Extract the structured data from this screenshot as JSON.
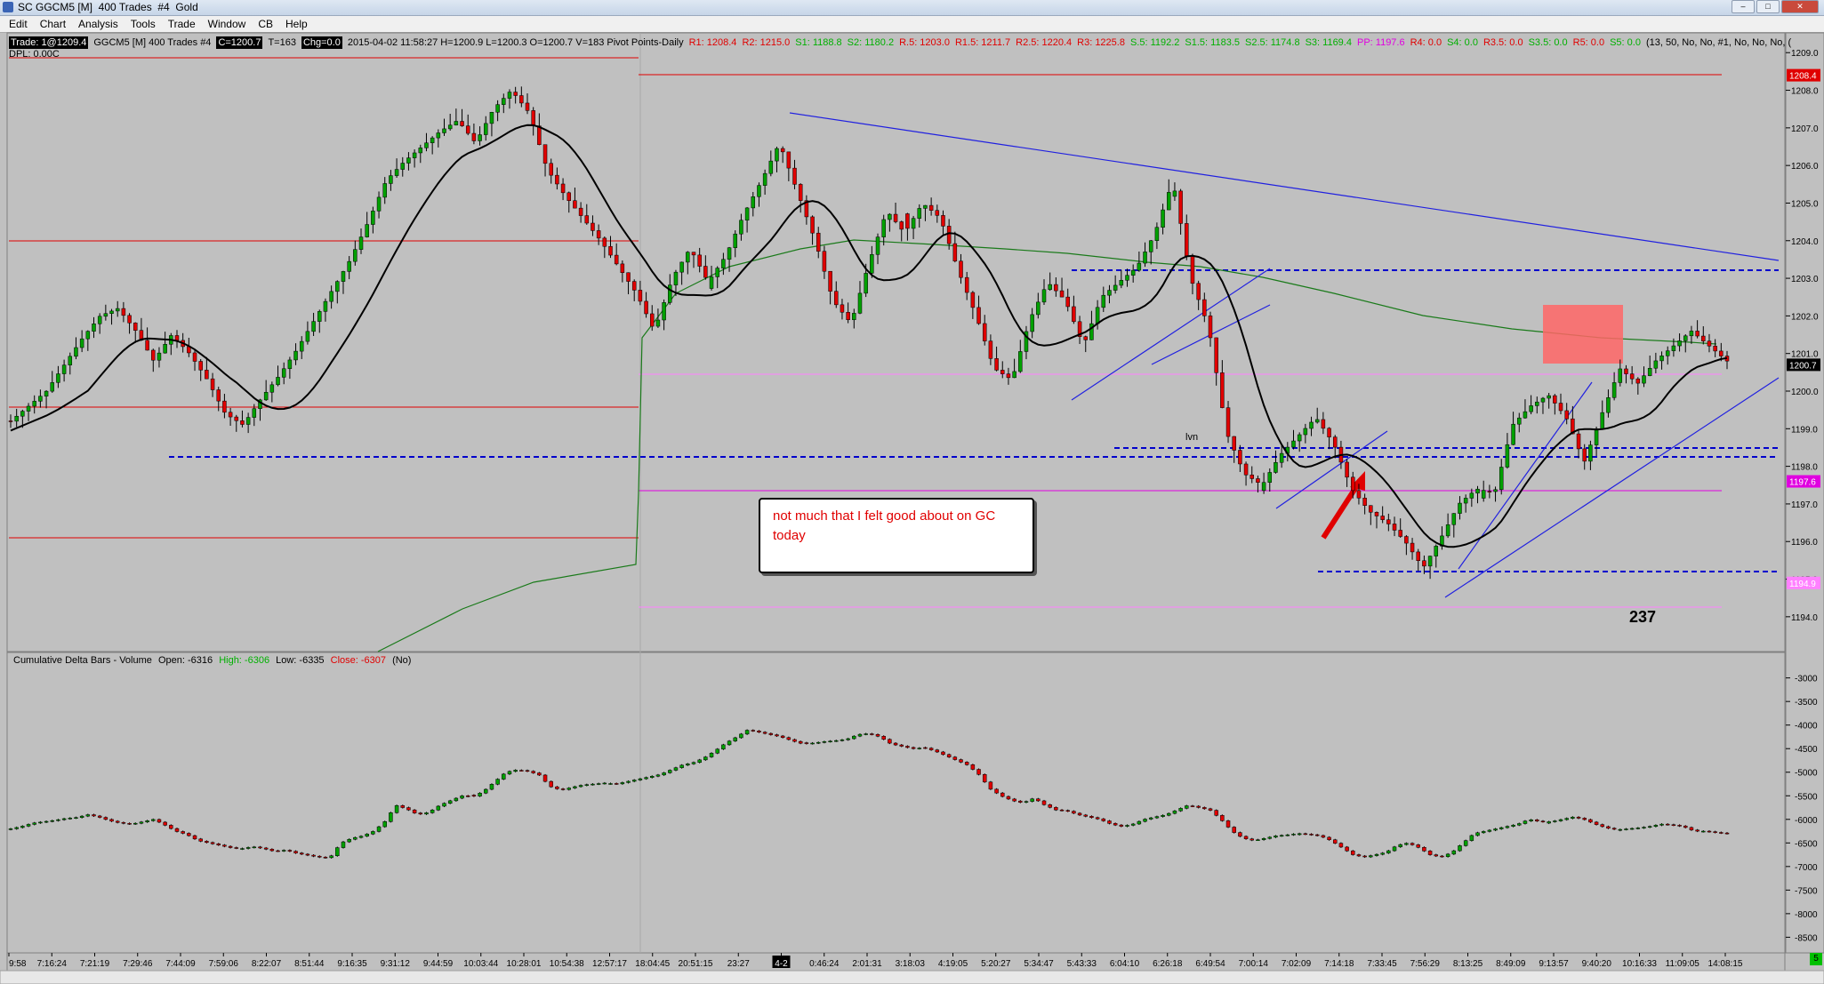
{
  "window": {
    "title": "SC GGCM5 [M]  400 Trades  #4  Gold",
    "buttons": [
      "–",
      "□",
      "✕"
    ]
  },
  "menu": [
    "Edit",
    "Chart",
    "Analysis",
    "Tools",
    "Trade",
    "Window",
    "CB",
    "Help"
  ],
  "info": {
    "trade": "Trade: 1@1209.4",
    "symbol": "GGCM5 [M]  400 Trades  #4",
    "close": "C=1200.7",
    "trades": "T=163",
    "chg": "Chg=0.0",
    "datetime": "2015-04-02 11:58:27 H=1200.9 L=1200.3 O=1200.7 V=183 Pivot Points-Daily",
    "dpl": "DPL: 0.00C",
    "pivots": [
      {
        "text": "R1: 1208.4",
        "color": "#e00000"
      },
      {
        "text": "R2: 1215.0",
        "color": "#e00000"
      },
      {
        "text": "S1: 1188.8",
        "color": "#00b000"
      },
      {
        "text": "S2: 1180.2",
        "color": "#00b000"
      },
      {
        "text": "R.5: 1203.0",
        "color": "#e00000"
      },
      {
        "text": "R1.5: 1211.7",
        "color": "#e00000"
      },
      {
        "text": "R2.5: 1220.4",
        "color": "#e00000"
      },
      {
        "text": "R3: 1225.8",
        "color": "#e00000"
      },
      {
        "text": "S.5: 1192.2",
        "color": "#00b000"
      },
      {
        "text": "S1.5: 1183.5",
        "color": "#00b000"
      },
      {
        "text": "S2.5: 1174.8",
        "color": "#00b000"
      },
      {
        "text": "S3: 1169.4",
        "color": "#00b000"
      },
      {
        "text": "PP: 1197.6",
        "color": "#e000e0"
      },
      {
        "text": "R4: 0.0",
        "color": "#e00000"
      },
      {
        "text": "S4: 0.0",
        "color": "#00b000"
      },
      {
        "text": "R3.5: 0.0",
        "color": "#e00000"
      },
      {
        "text": "S3.5: 0.0",
        "color": "#00b000"
      },
      {
        "text": "R5: 0.0",
        "color": "#e00000"
      },
      {
        "text": "S5: 0.0",
        "color": "#00b000"
      },
      {
        "text": "(13, 50, No, No, #1, No, No, No, (",
        "color": "#000000"
      }
    ]
  },
  "lower_legend": {
    "name": "Cumulative Delta Bars - Volume",
    "open": "Open: -6316",
    "high": "High: -6306",
    "low": "Low: -6335",
    "close": "Close: -6307",
    "extra": "(No)"
  },
  "annotation": {
    "line1": "not much that I felt good about on GC",
    "line2": "today"
  },
  "big_number": "237",
  "lvn_label": "lvn",
  "status_corner": "5",
  "colors": {
    "up": "#00a000",
    "down": "#e00000",
    "bg": "#c0c0c0",
    "blue_dash": "#0000cc",
    "pivot_pp": "#e000e0"
  },
  "chart_data": [
    {
      "type": "candlestick",
      "y_ticks": [
        "1209.0",
        "1208.0",
        "1207.0",
        "1206.0",
        "1205.0",
        "1204.0",
        "1203.0",
        "1202.0",
        "1201.0",
        "1200.0",
        "1199.0",
        "1198.0",
        "1197.0",
        "1196.0",
        "1195.0",
        "1194.0"
      ],
      "ylim": [
        1193.5,
        1209.1
      ],
      "price_labels": [
        {
          "text": "1208.4",
          "value": 1208.4,
          "bg": "#e00000",
          "fg": "#ffffff"
        },
        {
          "text": "1200.7",
          "value": 1200.7,
          "bg": "#000000",
          "fg": "#ffffff"
        },
        {
          "text": "1197.6",
          "value": 1197.6,
          "bg": "#e000e0",
          "fg": "#ffffff"
        },
        {
          "text": "1194.9",
          "value": 1194.9,
          "bg": "#ff80ff",
          "fg": "#ffffff"
        }
      ],
      "close_path": [
        1199.2,
        1199.6,
        1200.0,
        1200.7,
        1201.4,
        1202.0,
        1202.2,
        1201.6,
        1200.8,
        1201.5,
        1201.0,
        1200.3,
        1199.4,
        1199.1,
        1199.8,
        1200.4,
        1201.1,
        1201.9,
        1202.7,
        1203.5,
        1204.5,
        1205.6,
        1206.1,
        1206.5,
        1206.9,
        1207.2,
        1206.6,
        1207.5,
        1208.0,
        1207.4,
        1205.9,
        1205.2,
        1204.6,
        1204.0,
        1203.3,
        1202.6,
        1201.6,
        1203.0,
        1203.8,
        1202.9,
        1203.6,
        1204.7,
        1205.6,
        1206.6,
        1205.3,
        1204.0,
        1202.4,
        1201.8,
        1203.4,
        1204.8,
        1204.2,
        1205.0,
        1204.6,
        1203.2,
        1202.0,
        1200.6,
        1200.3,
        1201.9,
        1202.9,
        1202.4,
        1201.2,
        1202.5,
        1202.9,
        1203.3,
        1204.2,
        1205.6,
        1203.0,
        1201.7,
        1198.9,
        1197.8,
        1197.5,
        1198.3,
        1198.8,
        1199.3,
        1198.6,
        1197.4,
        1196.8,
        1196.5,
        1196.0,
        1195.3,
        1196.1,
        1197.0,
        1197.4,
        1197.3,
        1199.1,
        1199.6,
        1199.9,
        1199.3,
        1198.1,
        1199.4,
        1200.6,
        1200.2,
        1200.8,
        1201.2,
        1201.6,
        1201.2,
        1200.8
      ]
    },
    {
      "type": "candlestick",
      "title": "Cumulative Delta Bars - Volume",
      "y_ticks": [
        "-3000",
        "-3500",
        "-4000",
        "-4500",
        "-5000",
        "-5500",
        "-6000",
        "-6500",
        "-7000",
        "-7500",
        "-8000",
        "-8500"
      ],
      "ylim": [
        -8700,
        -2950
      ],
      "close_path": [
        -6200,
        -6150,
        -6080,
        -6050,
        -6020,
        -5980,
        -5960,
        -5900,
        -5950,
        -6030,
        -6080,
        -6100,
        -6050,
        -6000,
        -6120,
        -6250,
        -6320,
        -6450,
        -6500,
        -6550,
        -6600,
        -6620,
        -6580,
        -6620,
        -6680,
        -6650,
        -6720,
        -6760,
        -6800,
        -6820,
        -6500,
        -6400,
        -6350,
        -6250,
        -6050,
        -5700,
        -5780,
        -5900,
        -5850,
        -5700,
        -5600,
        -5500,
        -5520,
        -5400,
        -5200,
        -5000,
        -4950,
        -4980,
        -5050,
        -5300,
        -5380,
        -5320,
        -5270,
        -5250,
        -5230,
        -5250,
        -5200,
        -5150,
        -5100,
        -5050,
        -4950,
        -4850,
        -4800,
        -4700,
        -4550,
        -4380,
        -4250,
        -4100,
        -4150,
        -4200,
        -4250,
        -4330,
        -4400,
        -4380,
        -4350,
        -4330,
        -4300,
        -4200,
        -4180,
        -4250,
        -4400,
        -4450,
        -4500,
        -4480,
        -4550,
        -4650,
        -4750,
        -4850,
        -5050,
        -5350,
        -5500,
        -5600,
        -5650,
        -5550,
        -5700,
        -5800,
        -5820,
        -5900,
        -5950,
        -6000,
        -6100,
        -6150,
        -6100,
        -6000,
        -5950,
        -5900,
        -5800,
        -5700,
        -5750,
        -5800,
        -6000,
        -6250,
        -6400,
        -6450,
        -6400,
        -6350,
        -6330,
        -6300,
        -6320,
        -6350,
        -6450,
        -6600,
        -6750,
        -6800,
        -6750,
        -6700,
        -6550,
        -6500,
        -6600,
        -6750,
        -6800,
        -6700,
        -6500,
        -6300,
        -6250,
        -6200,
        -6150,
        -6100,
        -6000,
        -6050,
        -6050,
        -6000,
        -5950,
        -6000,
        -6100,
        -6180,
        -6220,
        -6200,
        -6180,
        -6150,
        -6100,
        -6120,
        -6150,
        -6250,
        -6250,
        -6280,
        -6300
      ]
    }
  ],
  "x_ticks": [
    "9:58",
    "7:16:24",
    "7:21:19",
    "7:29:46",
    "7:44:09",
    "7:59:06",
    "8:22:07",
    "8:51:44",
    "9:16:35",
    "9:31:12",
    "9:44:59",
    "10:03:44",
    "10:28:01",
    "10:54:38",
    "12:57:17",
    "18:04:45",
    "20:51:15",
    "23:27",
    "4-2",
    "0:46:24",
    "2:01:31",
    "3:18:03",
    "4:19:05",
    "5:20:27",
    "5:34:47",
    "5:43:33",
    "6:04:10",
    "6:26:18",
    "6:49:54",
    "7:00:14",
    "7:02:09",
    "7:14:18",
    "7:33:45",
    "7:56:29",
    "8:13:25",
    "8:49:09",
    "9:13:57",
    "9:40:20",
    "10:16:33",
    "11:09:05",
    "14:08:15"
  ]
}
